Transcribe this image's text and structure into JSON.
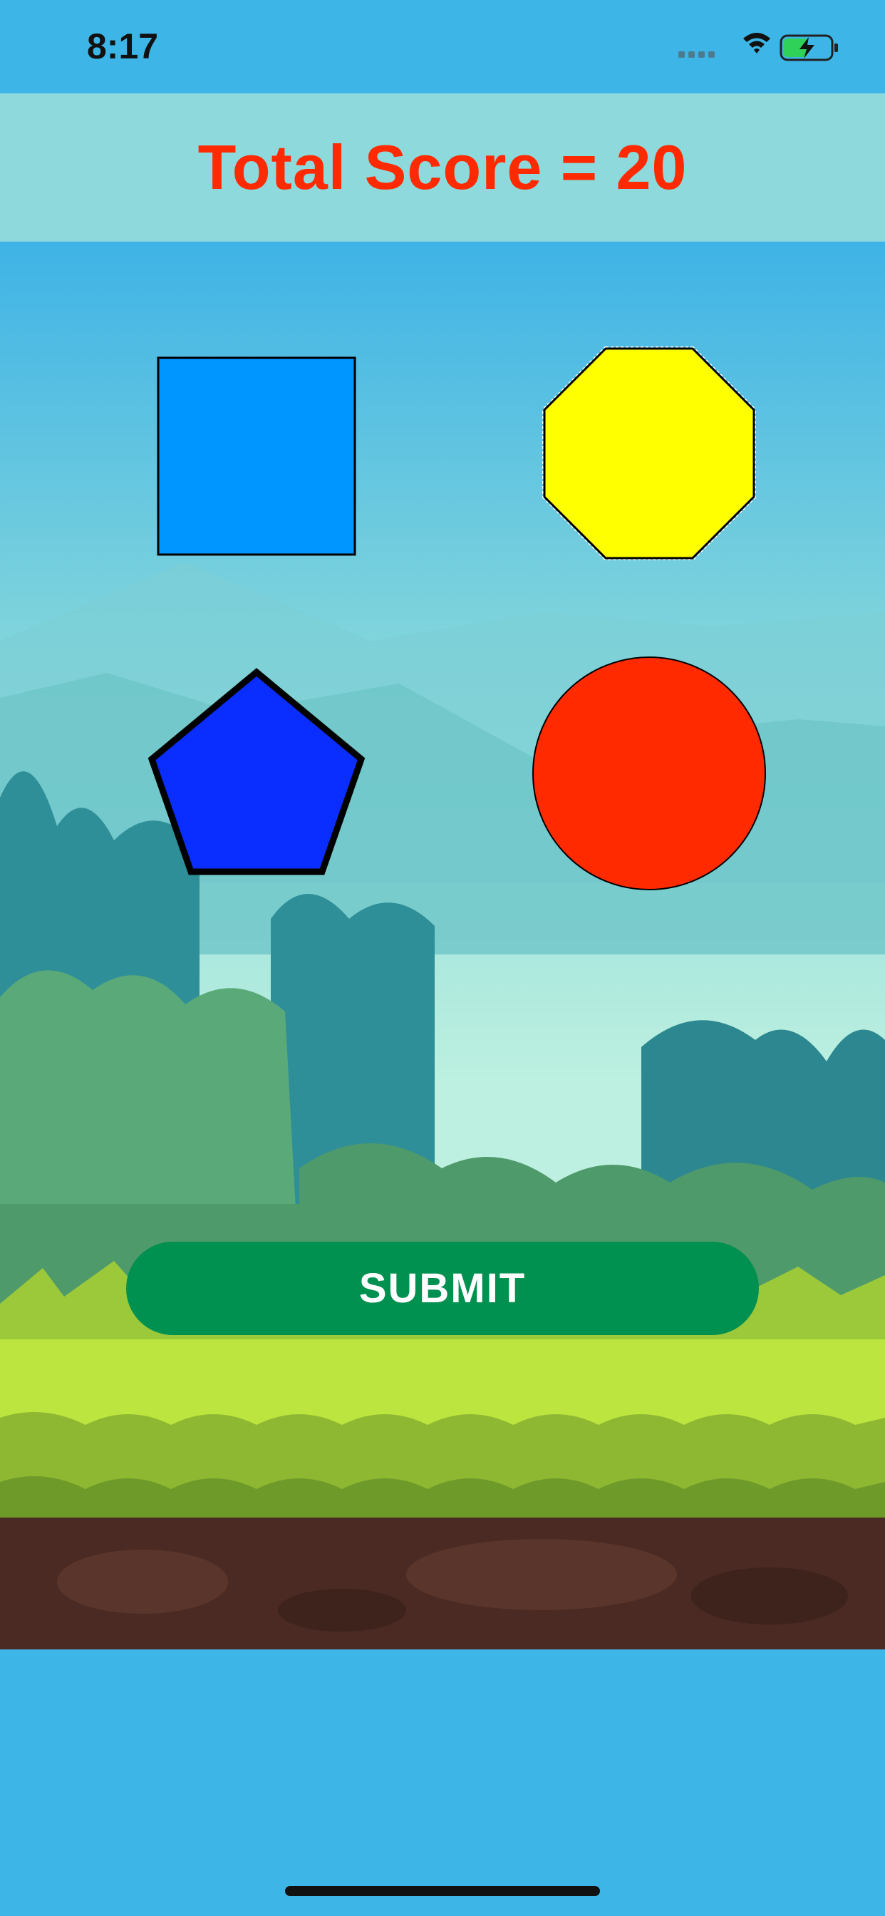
{
  "status_bar": {
    "time": "8:17",
    "icons": [
      "signal-icon",
      "wifi-icon",
      "battery-charging-icon"
    ]
  },
  "header": {
    "score_text": "Total Score = 20"
  },
  "shapes": [
    {
      "name": "square",
      "color": "#0096ff",
      "outline": "#000000"
    },
    {
      "name": "octagon",
      "color": "#ffff00",
      "outline": "#000000"
    },
    {
      "name": "pentagon",
      "color": "#0a2eff",
      "outline": "#000000"
    },
    {
      "name": "circle",
      "color": "#ff2a00",
      "outline": "#000000"
    }
  ],
  "submit": {
    "label": "SUBMIT",
    "color": "#009050"
  },
  "colors": {
    "sky": "#3db5e6",
    "header_bg": "#8dd9dc",
    "score_text": "#ff2a00"
  }
}
